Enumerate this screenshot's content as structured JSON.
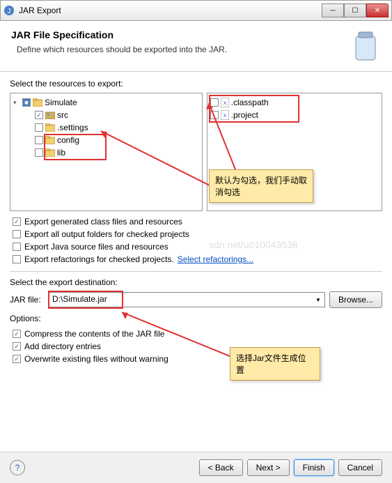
{
  "window": {
    "title": "JAR Export"
  },
  "header": {
    "title": "JAR File Specification",
    "desc": "Define which resources should be exported into the JAR."
  },
  "resources": {
    "label": "Select the resources to export:",
    "tree": {
      "root": "Simulate",
      "src": "src",
      "settings": ".settings",
      "config": "config",
      "lib": "lib"
    },
    "files": {
      "classpath": ".classpath",
      "project": ".project"
    }
  },
  "exportOptions": {
    "genClass": "Export generated class files and resources",
    "allOutput": "Export all output folders for checked projects",
    "javaSource": "Export Java source files and resources",
    "refactorings": "Export refactorings for checked projects.",
    "refactoringsLink": "Select refactorings..."
  },
  "destination": {
    "label": "Select the export destination:",
    "fieldLabel": "JAR file:",
    "value": "D:\\Simulate.jar",
    "browse": "Browse..."
  },
  "options": {
    "label": "Options:",
    "compress": "Compress the contents of the JAR file",
    "addDir": "Add directory entries",
    "overwrite": "Overwrite existing files without warning"
  },
  "annotations": {
    "note1": "默认为勾选，我们手动取消勾选",
    "note2": "选择Jar文件生成位置"
  },
  "buttons": {
    "back": "< Back",
    "next": "Next >",
    "finish": "Finish",
    "cancel": "Cancel"
  },
  "watermark": "sdn.net/u010043538"
}
